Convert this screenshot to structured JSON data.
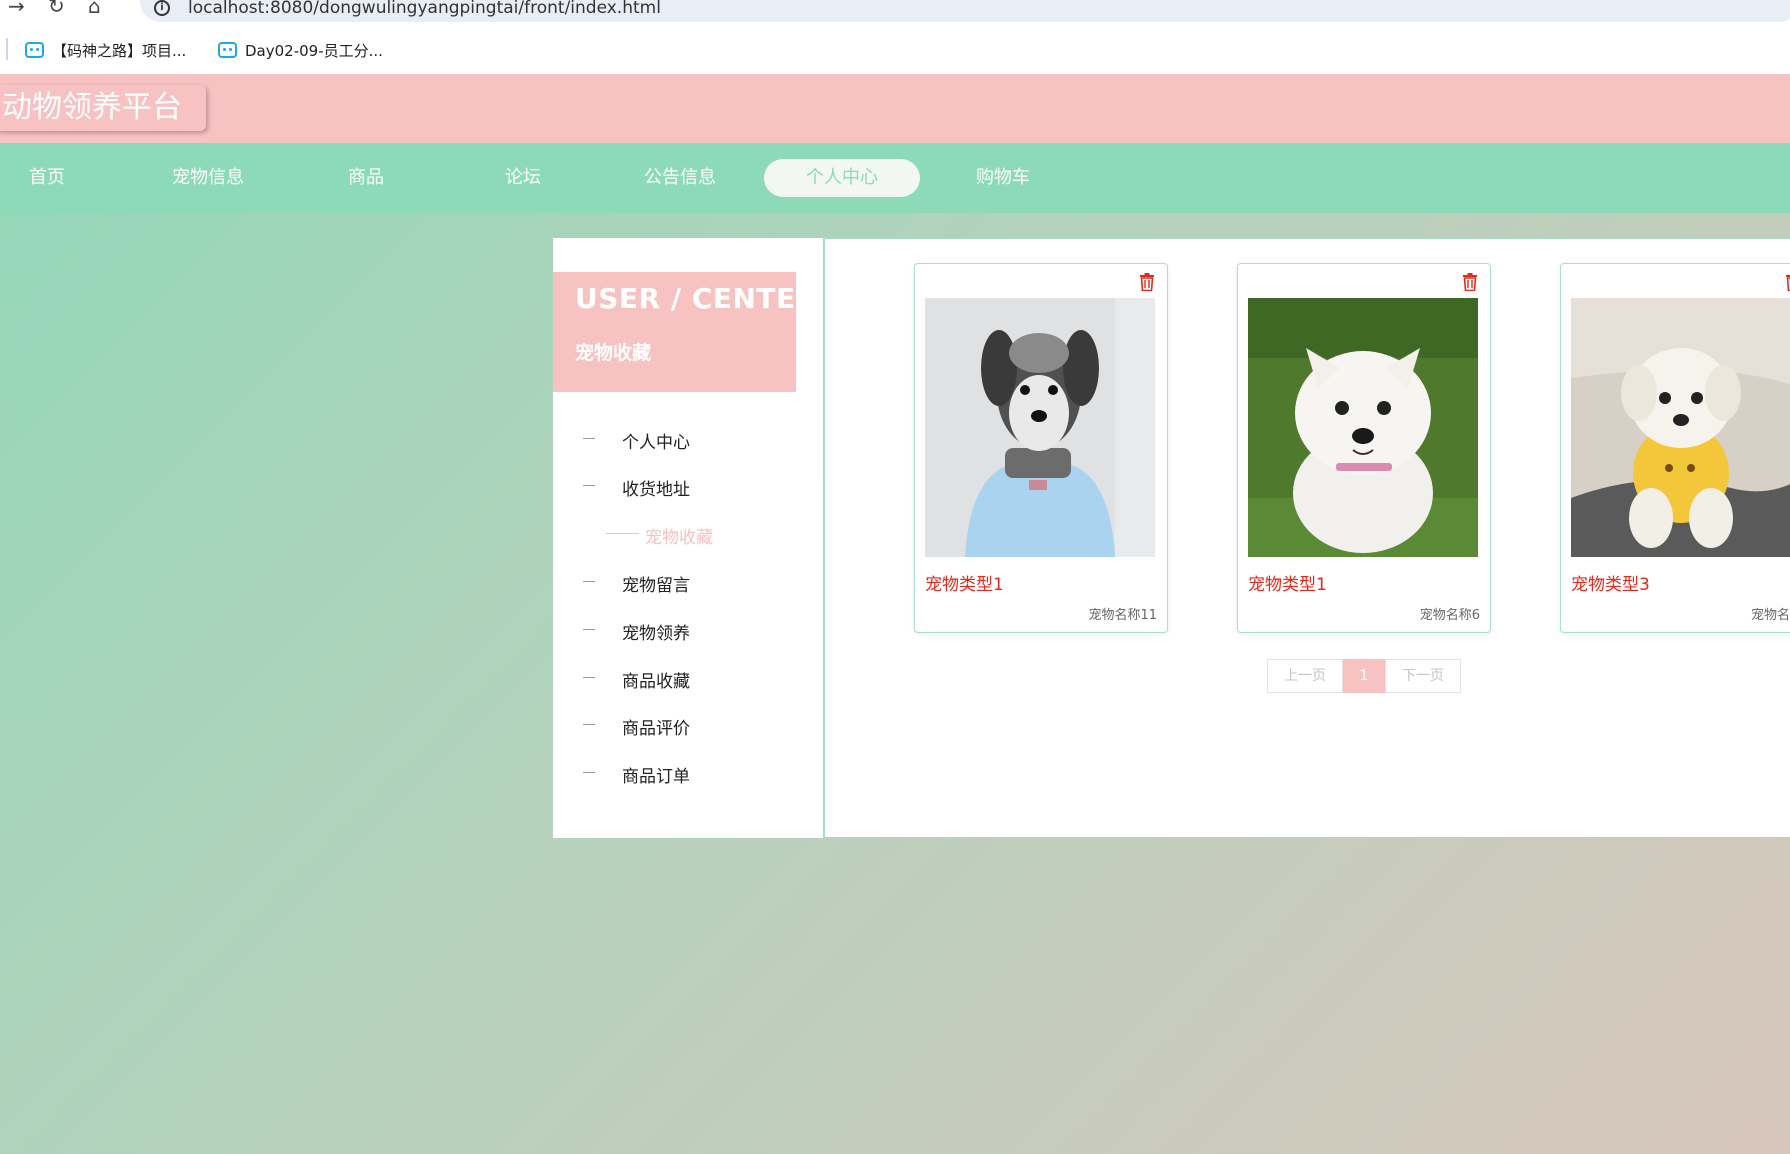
{
  "browser": {
    "url": "localhost:8080/dongwulingyangpingtai/front/index.html",
    "bookmarks": [
      {
        "label": "【码神之路】项目..."
      },
      {
        "label": "Day02-09-员工分..."
      }
    ]
  },
  "header": {
    "logo": "动物领养平台"
  },
  "nav": {
    "items": [
      {
        "label": "首页"
      },
      {
        "label": "宠物信息"
      },
      {
        "label": "商品"
      },
      {
        "label": "论坛"
      },
      {
        "label": "公告信息"
      },
      {
        "label": "个人中心",
        "active": true
      },
      {
        "label": "购物车"
      }
    ]
  },
  "sidebar": {
    "title": "USER / CENTER",
    "subtitle": "宠物收藏",
    "items": [
      {
        "label": "个人中心"
      },
      {
        "label": "收货地址"
      },
      {
        "label": "宠物收藏",
        "active": true
      },
      {
        "label": "宠物留言"
      },
      {
        "label": "宠物领养"
      },
      {
        "label": "商品收藏"
      },
      {
        "label": "商品评价"
      },
      {
        "label": "商品订单"
      }
    ]
  },
  "favorites": [
    {
      "type": "宠物类型1",
      "name": "宠物名称11",
      "image": "schnauzer-dog"
    },
    {
      "type": "宠物类型1",
      "name": "宠物名称6",
      "image": "westie-dog"
    },
    {
      "type": "宠物类型3",
      "name": "宠物名称",
      "image": "maltese-dog"
    }
  ],
  "pager": {
    "prev": "上一页",
    "current": "1",
    "next": "下一页"
  },
  "colors": {
    "pink": "#f7c2c2",
    "mint": "#8cdab8",
    "red": "#e8271b"
  }
}
